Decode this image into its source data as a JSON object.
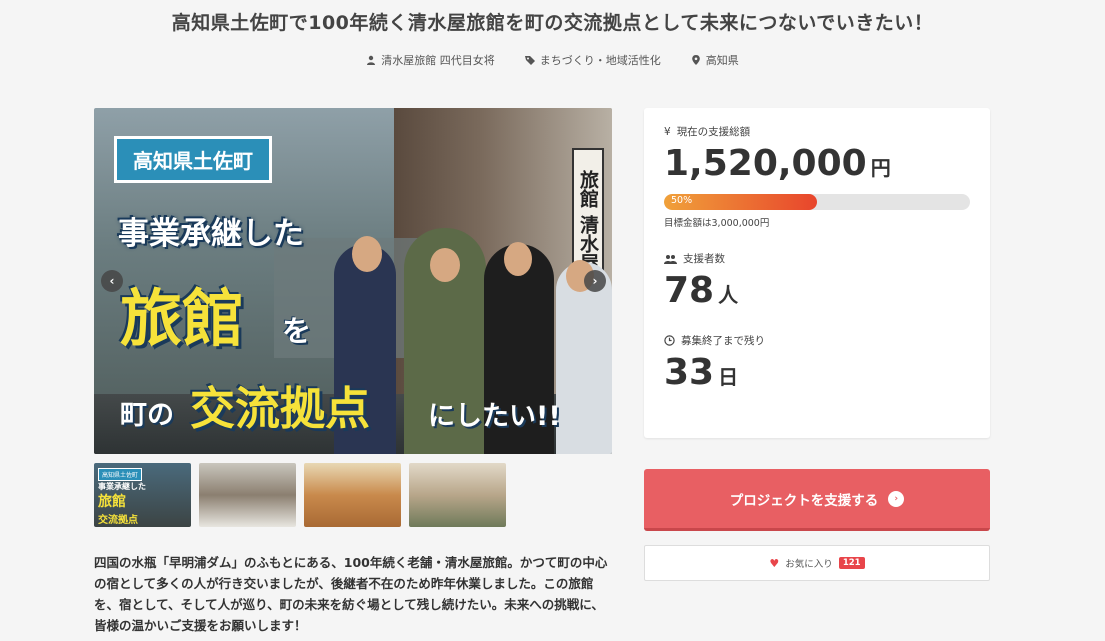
{
  "project": {
    "title": "高知県土佐町で100年続く清水屋旅館を町の交流拠点として未来につないでいきたい！",
    "owner": "清水屋旅館 四代目女将",
    "category": "まちづくり・地域活性化",
    "location": "高知県"
  },
  "hero": {
    "location_tag": "高知県土佐町",
    "line1": "事業承継した",
    "line2": "旅館",
    "line2_particle": "を",
    "line3_prefix": "町の",
    "line3_highlight": "交流拠点",
    "line3_suffix": "にしたい!!",
    "sign_text": "旅館 清水屋"
  },
  "thumbnails": {
    "t1_tag": "高知県土佐町",
    "t1_line1": "事業承継した",
    "t1_line2": "旅館",
    "t1_line3": "交流拠点"
  },
  "description": "四国の水瓶「早明浦ダム」のふもとにある、100年続く老舗・清水屋旅館。かつて町の中心の宿として多くの人が行き交いましたが、後継者不在のため昨年休業しました。この旅館を、宿として、そして人が巡り、町の未来を紡ぐ場として残し続けたい。未来への挑戦に、皆様の温かいご支援をお願いします！",
  "stats": {
    "total_label": "現在の支援総額",
    "total_value": "1,520,000",
    "total_unit": "円",
    "progress": 0.5,
    "progress_text": "50%",
    "goal_text": "目標金額は3,000,000円",
    "supporters_label": "支援者数",
    "supporters_value": "78",
    "supporters_unit": "人",
    "remaining_label": "募集終了まで残り",
    "remaining_value": "33",
    "remaining_unit": "日",
    "currency_symbol": "¥"
  },
  "actions": {
    "support_label": "プロジェクトを支援する",
    "favorite_label": "お気に入り",
    "favorite_count": "121"
  },
  "colors": {
    "accent": "#e85f63",
    "progress_start": "#f0a13a",
    "progress_end": "#e8452c"
  }
}
